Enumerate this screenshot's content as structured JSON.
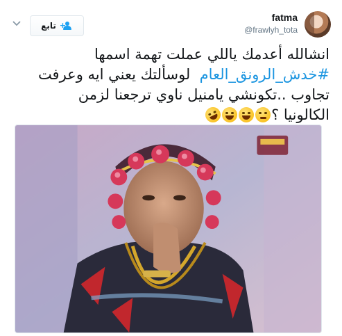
{
  "author": {
    "display_name": "fatma",
    "handle": "@frawlyh_tota",
    "avatar_icon": "avatar-photo"
  },
  "actions": {
    "follow_label": "تابع",
    "follow_icon": "add-user-icon",
    "menu_icon": "chevron-down-icon"
  },
  "tweet": {
    "lines": [
      "انشالله أعدمك ياللي عملت تهمة اسمها",
      "لوسألتك يعني ايه وعرفت",
      "تجاوب ..تكونشي يامنيل ناوي ترجعنا لزمن",
      "الكالونيا ؟"
    ],
    "hashtag": "#خدش_الرونق_العام",
    "emojis": [
      "thinking-face",
      "face-with-tears-of-joy",
      "face-with-tears-of-joy",
      "rolling-on-floor-laughing"
    ]
  },
  "media": {
    "description_icon": "photo-actor-costume"
  },
  "colors": {
    "link": "#1b95e0",
    "accent": "#1da1f2",
    "text": "#14171a",
    "secondary": "#657786"
  }
}
